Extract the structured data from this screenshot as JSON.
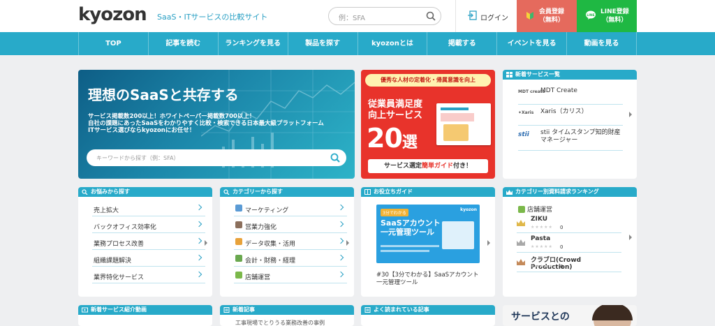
{
  "header": {
    "logo": "kyozon",
    "tagline": "SaaS・ITサービスの比較サイト",
    "search_placeholder": "例：SFA",
    "login": "ログイン",
    "register": [
      "会員登録",
      "（無料）"
    ],
    "line": [
      "LINE登録",
      "（無料）"
    ],
    "colors": {
      "accent": "#28aac9",
      "register": "#e56a5d",
      "line": "#1fb843"
    }
  },
  "nav": [
    "TOP",
    "記事を読む",
    "ランキングを見る",
    "製品を探す",
    "kyozonとは",
    "掲載する",
    "イベントを見る",
    "動画を見る"
  ],
  "hero": {
    "title": "理想のSaaSと共存する",
    "lines": [
      "サービス掲載数200以上！ホワイトペーパー掲載数700以上！",
      "自社の課題にあったSaaSをわかりやすく比較・検索できる日本最大級プラットフォーム",
      "ITサービス選びならkyozonにお任せ！"
    ],
    "search_placeholder": "キーワードから探す（例：SFA）"
  },
  "banner": {
    "top": "優秀な人材の定着化・帰属意識を向上",
    "line1": "従業員満足度",
    "line2": "向上サービス",
    "big_num": "20",
    "big_unit": "選",
    "bottom_pre": "サービス選定",
    "bottom_em": "簡単ガイド",
    "bottom_post": "付き！"
  },
  "new_services": {
    "title": "新着サービス一覧",
    "items": [
      {
        "logo": "MDT create",
        "name": "MDT Create"
      },
      {
        "logo": "✦Xaris",
        "name": "Xaris（カリス）"
      },
      {
        "logo": "stii",
        "name": "stii タイムスタンプ知的財産マネージャー"
      }
    ]
  },
  "worries": {
    "title": "お悩みから探す",
    "items": [
      "売上拡大",
      "バックオフィス効率化",
      "業務プロセス改善",
      "組織課題解決",
      "業界特化サービス"
    ]
  },
  "categories": {
    "title": "カテゴリーから探す",
    "items": [
      "マーケティング",
      "営業力強化",
      "データ収集・活用",
      "会計・財務・経理",
      "店舗運営"
    ]
  },
  "guide": {
    "title": "お役立ちガイド",
    "img_badge": "3分でわかる",
    "img_title": "SaaSアカウント一元管理ツール",
    "img_logo": "kyozon",
    "caption": "#30【3分でわかる】SaaSアカウント一元管理ツール"
  },
  "ranking": {
    "title": "カテゴリー別資料請求ランキング",
    "category": "店舗運営",
    "items": [
      {
        "name": "ZIKU",
        "stars": "★★★★★",
        "score": "0"
      },
      {
        "name": "Pasta",
        "stars": "★★★★★",
        "score": "0"
      },
      {
        "name": "クラブロ(Crowd Production)",
        "stars": "★★★★★",
        "score": "0"
      }
    ]
  },
  "bottom": {
    "video": "新着サービス紹介動画",
    "articles": "新着記事",
    "articles_snippet": "工事現場でとりうる業務改善の事例",
    "popular": "よく読まれている記事",
    "ad": "サービスとの"
  }
}
